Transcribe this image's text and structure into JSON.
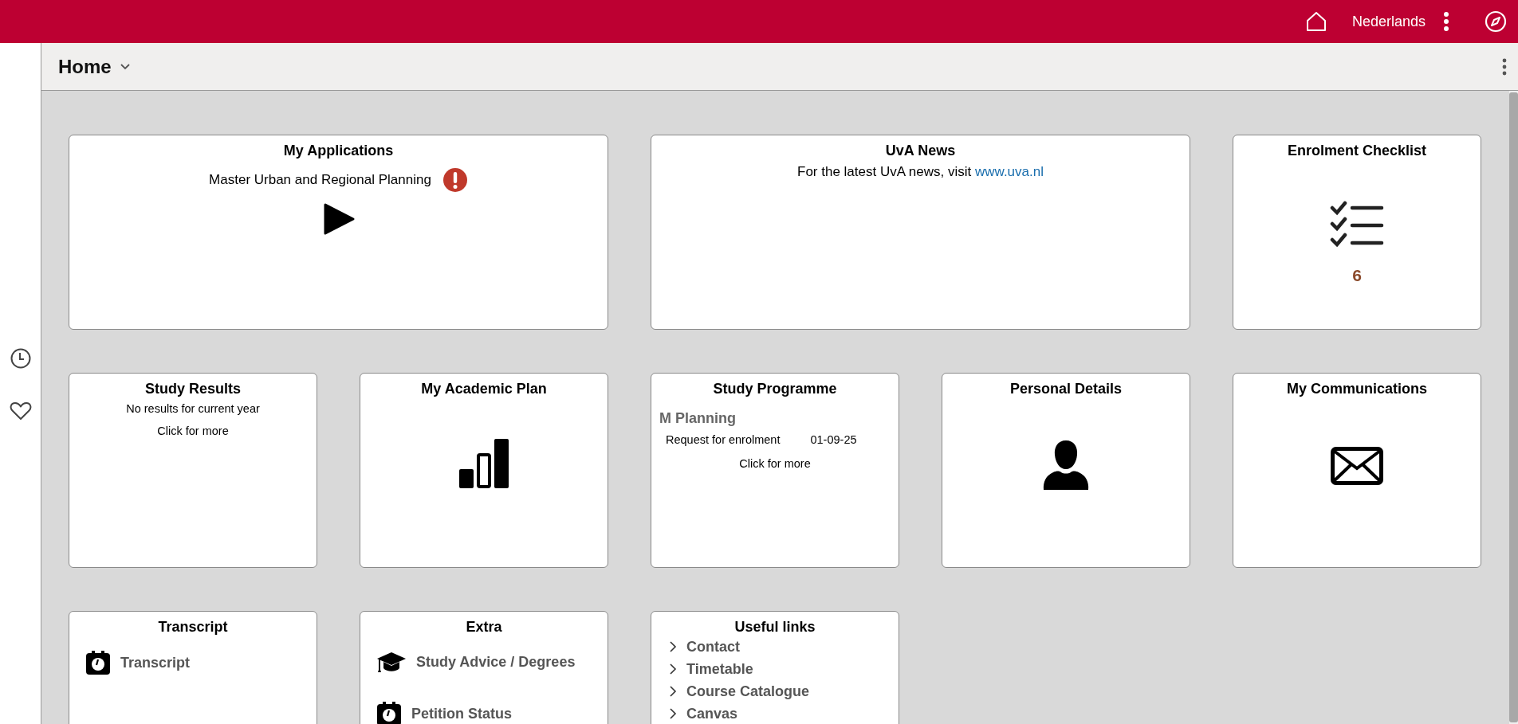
{
  "topbar": {
    "language": "Nederlands"
  },
  "header": {
    "title": "Home"
  },
  "tiles": [
    {
      "kind": "applications",
      "title": "My Applications",
      "item": "Master Urban and Regional Planning",
      "alert": true
    },
    {
      "kind": "news",
      "title": "UvA News",
      "text": "For the latest UvA news, visit",
      "link": "www.uva.nl"
    },
    {
      "kind": "checklist",
      "title": "Enrolment Checklist",
      "count": "6"
    },
    {
      "kind": "results",
      "title": "Study Results",
      "message": "No results for current year",
      "more": "Click for more"
    },
    {
      "kind": "plan",
      "title": "My Academic Plan"
    },
    {
      "kind": "programme",
      "title": "Study Programme",
      "programme": "M Planning",
      "status": "Request for enrolment",
      "date": "01-09-25",
      "more": "Click for more"
    },
    {
      "kind": "personal",
      "title": "Personal Details"
    },
    {
      "kind": "messages",
      "title": "My Communications"
    },
    {
      "kind": "links",
      "title": "Transcript",
      "links": [
        {
          "kind": "record",
          "label": "Transcript"
        }
      ]
    },
    {
      "kind": "links",
      "title": "Extra",
      "links": [
        {
          "kind": "advice",
          "label": "Study Advice / Degrees"
        },
        {
          "kind": "record",
          "label": "Petition Status"
        }
      ]
    },
    {
      "kind": "list",
      "title": "Useful links",
      "links": [
        "Contact",
        "Timetable",
        "Course Catalogue",
        "Canvas"
      ]
    }
  ]
}
